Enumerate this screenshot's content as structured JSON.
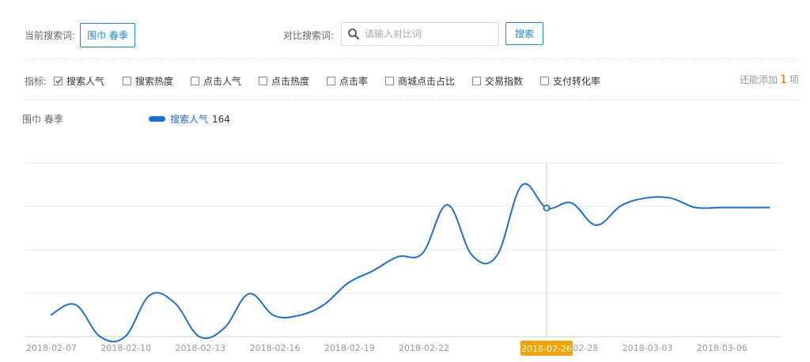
{
  "search": {
    "current_label": "当前搜索词:",
    "current_keyword": "围巾 春季",
    "compare_label": "对比搜索词:",
    "compare_placeholder": "请输入对比词",
    "search_button": "搜索"
  },
  "metrics": {
    "label": "指标:",
    "items": [
      {
        "label": "搜索人气",
        "checked": true
      },
      {
        "label": "搜索热度",
        "checked": false
      },
      {
        "label": "点击人气",
        "checked": false
      },
      {
        "label": "点击热度",
        "checked": false
      },
      {
        "label": "点击率",
        "checked": false
      },
      {
        "label": "商城点击占比",
        "checked": false
      },
      {
        "label": "交易指数",
        "checked": false
      },
      {
        "label": "支付转化率",
        "checked": false
      }
    ],
    "remaining_prefix": "还能添加",
    "remaining_count": "1",
    "remaining_suffix": "项"
  },
  "legend": {
    "keyword": "围巾 春季",
    "series_name": "搜索人气",
    "series_value": "164"
  },
  "chart_data": {
    "type": "line",
    "x_tick_labels": [
      "2018-02-07",
      "2018-02-10",
      "2018-02-13",
      "2018-02-16",
      "2018-02-19",
      "2018-02-22",
      "2018-02-26",
      "2018-02-28",
      "2018-03-03",
      "2018-03-06"
    ],
    "x": [
      "2018-02-06",
      "2018-02-07",
      "2018-02-08",
      "2018-02-09",
      "2018-02-10",
      "2018-02-11",
      "2018-02-12",
      "2018-02-13",
      "2018-02-14",
      "2018-02-15",
      "2018-02-16",
      "2018-02-17",
      "2018-02-18",
      "2018-02-19",
      "2018-02-20",
      "2018-02-21",
      "2018-02-22",
      "2018-02-23",
      "2018-02-24",
      "2018-02-25",
      "2018-02-26",
      "2018-02-27",
      "2018-02-28",
      "2018-03-01",
      "2018-03-02",
      "2018-03-03",
      "2018-03-04",
      "2018-03-05",
      "2018-03-06",
      "2018-03-07"
    ],
    "series": [
      {
        "name": "搜索人气",
        "color": "#1b6fd6",
        "values": [
          48,
          71,
          0,
          0,
          92,
          75,
          0,
          19,
          95,
          47,
          47,
          70,
          119,
          146,
          177,
          185,
          292,
          180,
          180,
          335,
          285,
          296,
          247,
          290,
          307,
          307,
          286,
          286,
          286,
          286
        ]
      }
    ],
    "highlight": {
      "x": "2018-02-26",
      "label": "2018-02-26",
      "value": 164
    },
    "ylim": [
      0,
      385
    ],
    "grid": true,
    "y_tick_labels_visible": false
  }
}
